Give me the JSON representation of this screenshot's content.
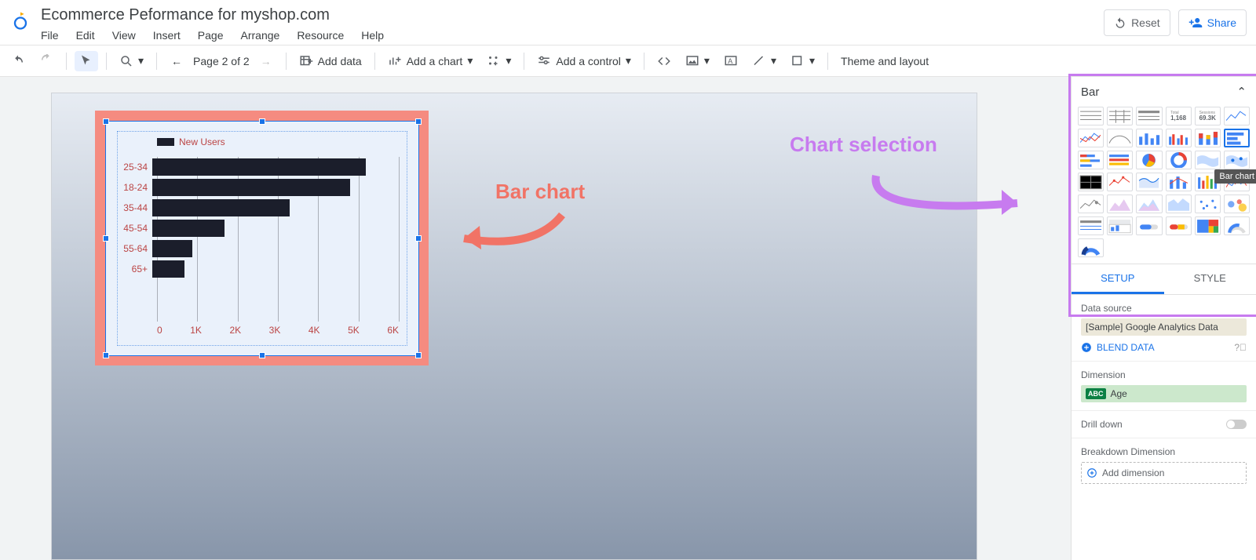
{
  "doc_title": "Ecommerce Peformance for myshop.com",
  "menu": [
    "File",
    "Edit",
    "View",
    "Insert",
    "Page",
    "Arrange",
    "Resource",
    "Help"
  ],
  "header_buttons": {
    "reset": "Reset",
    "share": "Share"
  },
  "toolbar": {
    "page_label": "Page 2 of 2",
    "add_data": "Add data",
    "add_chart": "Add a chart",
    "add_control": "Add a control",
    "theme": "Theme and layout"
  },
  "annotations": {
    "bar_chart": "Bar chart",
    "chart_selection": "Chart selection"
  },
  "chart_panel": {
    "title": "Bar",
    "tooltip": "Bar chart",
    "thumbs_count": 37,
    "selected_index": 11,
    "score1": "1,168",
    "score2": "69.3K"
  },
  "tabs": {
    "setup": "SETUP",
    "style": "STYLE"
  },
  "setup": {
    "data_source_label": "Data source",
    "data_source": "[Sample] Google Analytics Data",
    "blend": "BLEND DATA",
    "dimension_label": "Dimension",
    "dimension": "Age",
    "drill_label": "Drill down",
    "breakdown_label": "Breakdown Dimension",
    "add_dimension": "Add dimension"
  },
  "chart_data": {
    "type": "bar",
    "orientation": "horizontal",
    "legend": "New Users",
    "categories": [
      "25-34",
      "18-24",
      "35-44",
      "45-54",
      "55-64",
      "65+"
    ],
    "values": [
      5300,
      4900,
      3400,
      1800,
      1000,
      800
    ],
    "xlim": [
      0,
      6000
    ],
    "xticks": [
      "0",
      "1K",
      "2K",
      "3K",
      "4K",
      "5K",
      "6K"
    ]
  }
}
